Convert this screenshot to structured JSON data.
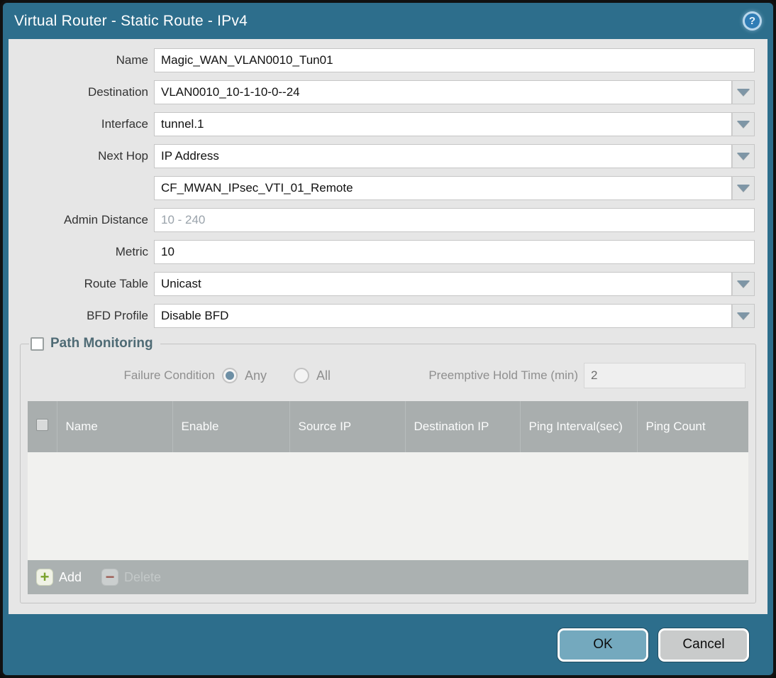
{
  "colors": {
    "titlebar_teal": "#2d6e8c",
    "content_gray": "#e6e6e6",
    "table_header_gray": "#a9aeae",
    "ok_button_blue": "#74a9be",
    "cancel_button_gray": "#c9cbcb",
    "add_plus_green": "#7aa22e",
    "delete_minus_red": "#9c4a40",
    "radio_selected_dot": "#6d8fa5",
    "dropdown_arrow": "#7e96a6"
  },
  "titlebar": {
    "title": "Virtual Router - Static Route - IPv4",
    "help_icon_glyph": "?"
  },
  "form": {
    "name": {
      "label": "Name",
      "value": "Magic_WAN_VLAN0010_Tun01"
    },
    "destination": {
      "label": "Destination",
      "value": "VLAN0010_10-1-10-0--24"
    },
    "interface": {
      "label": "Interface",
      "value": "tunnel.1"
    },
    "next_hop": {
      "label": "Next Hop",
      "value": "IP Address"
    },
    "next_hop_address": {
      "value": "CF_MWAN_IPsec_VTI_01_Remote"
    },
    "admin_distance": {
      "label": "Admin Distance",
      "value": "",
      "placeholder": "10 - 240"
    },
    "metric": {
      "label": "Metric",
      "value": "10"
    },
    "route_table": {
      "label": "Route Table",
      "value": "Unicast"
    },
    "bfd_profile": {
      "label": "BFD Profile",
      "value": "Disable BFD"
    }
  },
  "path_monitoring": {
    "title": "Path Monitoring",
    "checkbox_checked": false,
    "failure_condition": {
      "label": "Failure Condition",
      "options": [
        {
          "label": "Any",
          "selected": true
        },
        {
          "label": "All",
          "selected": false
        }
      ]
    },
    "preemptive_hold_time": {
      "label": "Preemptive Hold Time (min)",
      "value": "2"
    },
    "table": {
      "headers": [
        "Name",
        "Enable",
        "Source IP",
        "Destination IP",
        "Ping Interval(sec)",
        "Ping Count"
      ],
      "rows": []
    },
    "toolbar": {
      "add_label": "Add",
      "add_icon_glyph": "+",
      "delete_label": "Delete",
      "delete_icon_glyph": "−"
    }
  },
  "footer": {
    "ok_label": "OK",
    "cancel_label": "Cancel"
  }
}
